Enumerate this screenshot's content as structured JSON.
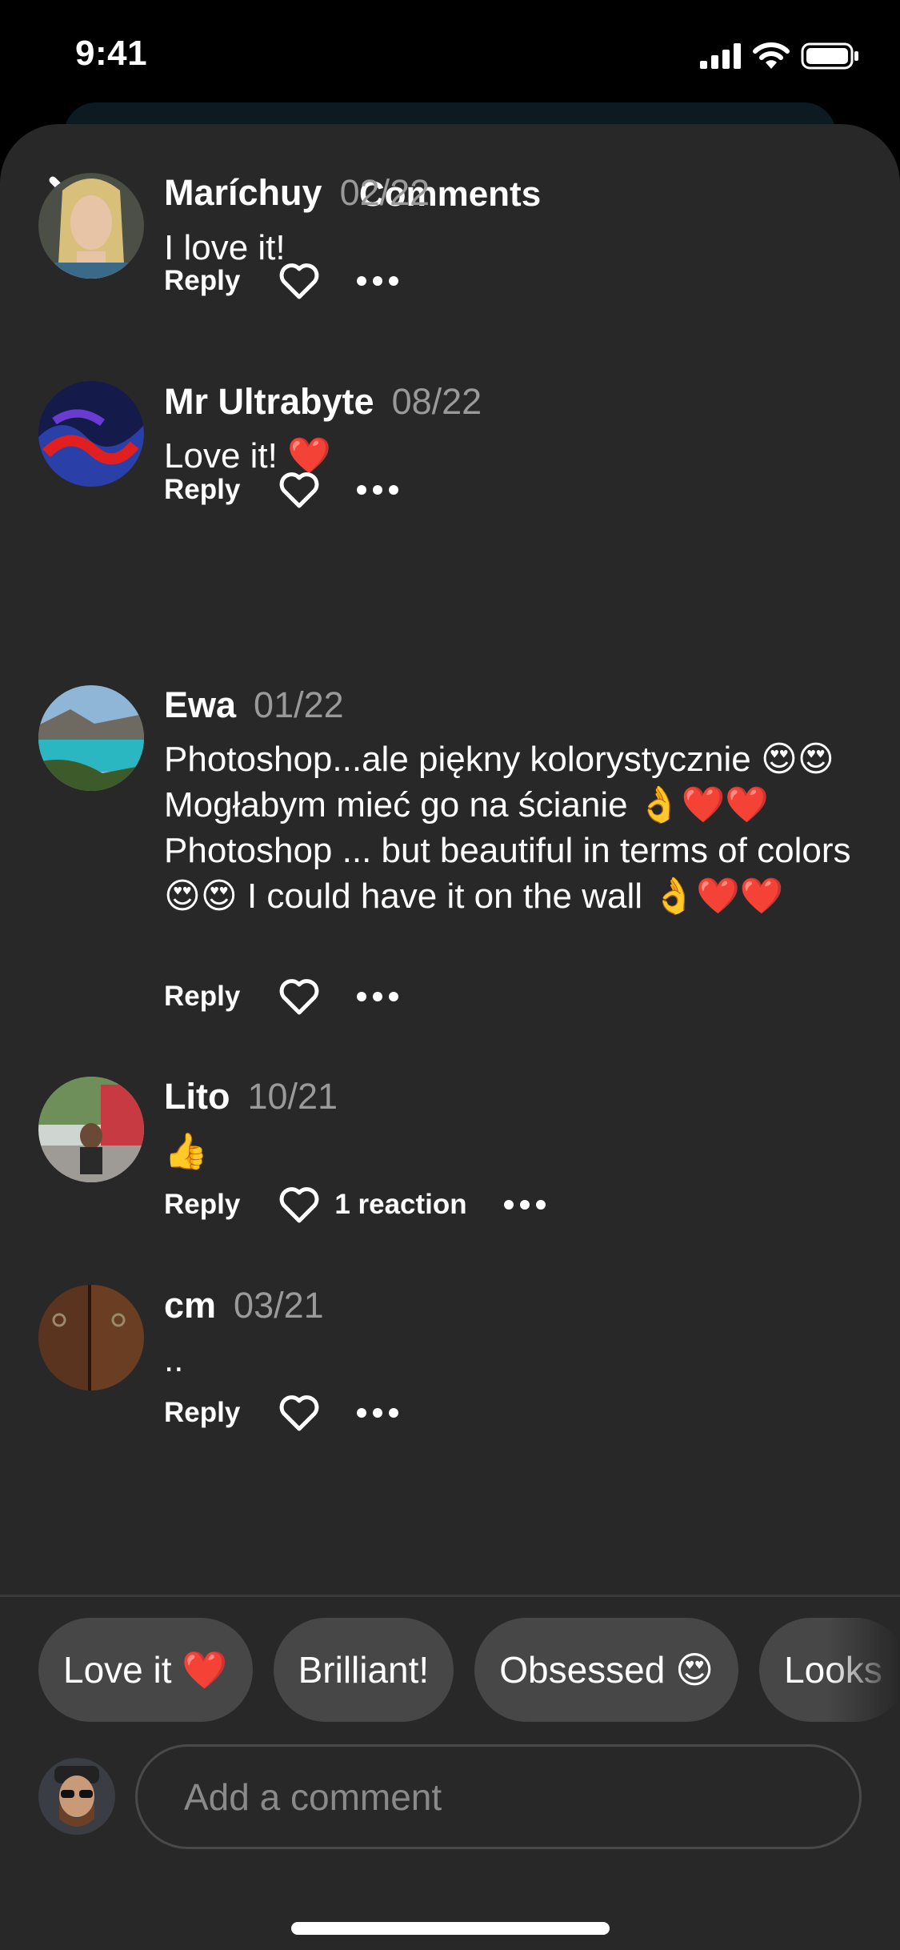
{
  "status_bar": {
    "time": "9:41"
  },
  "header": {
    "title": "Comments"
  },
  "comments": [
    {
      "name": "Maríchuy",
      "date": "02/22",
      "text": "I love it!",
      "reply_label": "Reply",
      "reactions": ""
    },
    {
      "name": "Mr Ultrabyte",
      "date": "08/22",
      "text": "Love it! ❤️",
      "reply_label": "Reply",
      "reactions": ""
    },
    {
      "name": "Ewa",
      "date": "01/22",
      "text": "Photoshop...ale piękny kolorystycznie 😍😍 Mogłabym mieć go na ścianie 👌❤️❤️ Photoshop ... but beautiful in terms of colors 😍😍 I could have it on the wall 👌❤️❤️",
      "reply_label": "Reply",
      "reactions": ""
    },
    {
      "name": "Lito",
      "date": "10/21",
      "text": "👍",
      "reply_label": "Reply",
      "reactions": "1 reaction"
    },
    {
      "name": "cm",
      "date": "03/21",
      "text": "..",
      "reply_label": "Reply",
      "reactions": ""
    }
  ],
  "quick_replies": [
    "Love it ❤️",
    "Brilliant!",
    "Obsessed 😍",
    "Looks"
  ],
  "composer": {
    "placeholder": "Add a comment"
  },
  "icons": {
    "close": "close-icon",
    "like": "heart-outline-icon",
    "more": "more-horizontal-icon",
    "signal": "cellular-signal-icon",
    "wifi": "wifi-icon",
    "battery": "battery-icon"
  },
  "colors": {
    "sheet_background": "#282828",
    "chip_background": "#474747",
    "secondary_text": "#9a9a9a"
  }
}
